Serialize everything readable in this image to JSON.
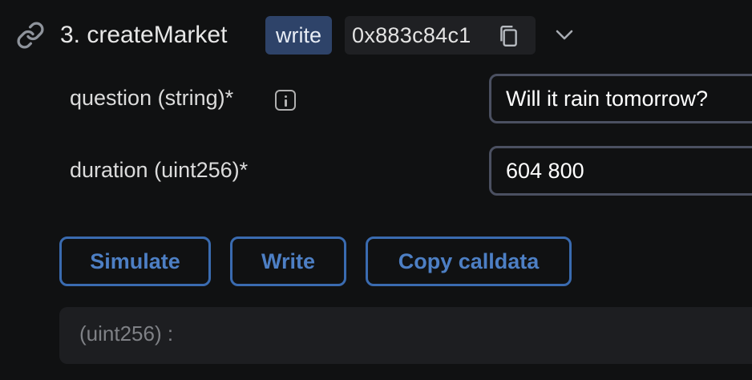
{
  "function": {
    "title": "3. createMarket",
    "access_badge": "write",
    "address": "0x883c84c1"
  },
  "icons": {
    "link": "link-icon",
    "copy": "copy-icon",
    "chevron": "chevron-down-icon",
    "info": "info-icon"
  },
  "params": [
    {
      "label": "question (string)*",
      "value": "Will it rain tomorrow?"
    },
    {
      "label": "duration (uint256)*",
      "value": "604 800"
    }
  ],
  "buttons": {
    "simulate": "Simulate",
    "write": "Write",
    "copy_calldata": "Copy calldata"
  },
  "result": {
    "text": "(uint256) :"
  },
  "colors": {
    "background": "#101112",
    "badge_bg": "#2e4369",
    "button_border": "#3a6bb0",
    "button_text": "#4d7fc4",
    "input_border": "#4b5061",
    "result_bg": "#1d1e21"
  }
}
